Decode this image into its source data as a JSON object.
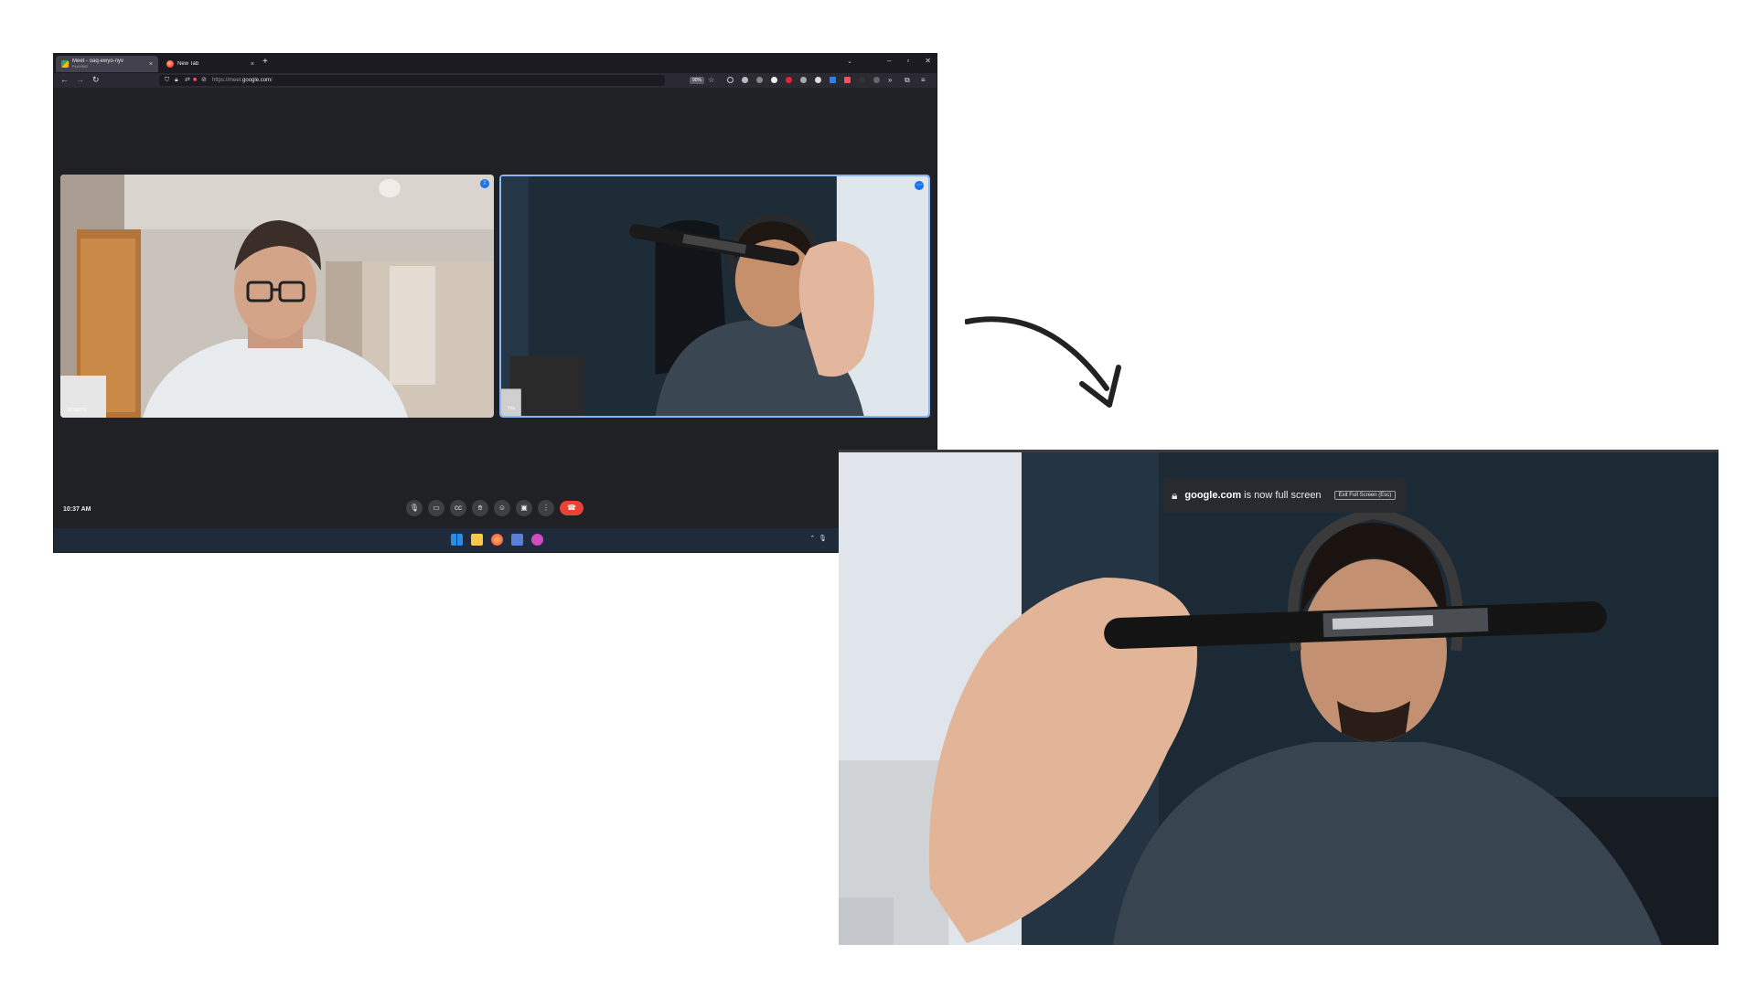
{
  "browser": {
    "tabs": [
      {
        "title": "Meet - oaq-ewyo-nyv",
        "subtitle": "PLAYING",
        "icon": "google-meet-icon"
      },
      {
        "title": "New Tab",
        "icon": "firefox-icon"
      }
    ],
    "url_prefix": "https://meet.",
    "url_domain": "google.com",
    "url_suffix": "/",
    "zoom": "90%"
  },
  "meet": {
    "participants": [
      {
        "name": "JOSEFFE"
      },
      {
        "name": "You"
      }
    ],
    "time": "10:37 AM",
    "controls": [
      "microphone-icon",
      "camera-icon",
      "captions-icon",
      "raise-hand-icon",
      "emoji-icon",
      "present-icon",
      "more-options-icon"
    ],
    "colors": {
      "background": "#202124",
      "active_border": "#8ab4f8",
      "hangup": "#ea4335"
    }
  },
  "fullscreen": {
    "notice_domain": "google.com",
    "notice_text": " is now full screen",
    "exit_label": "Exit Full Screen (Esc)"
  }
}
